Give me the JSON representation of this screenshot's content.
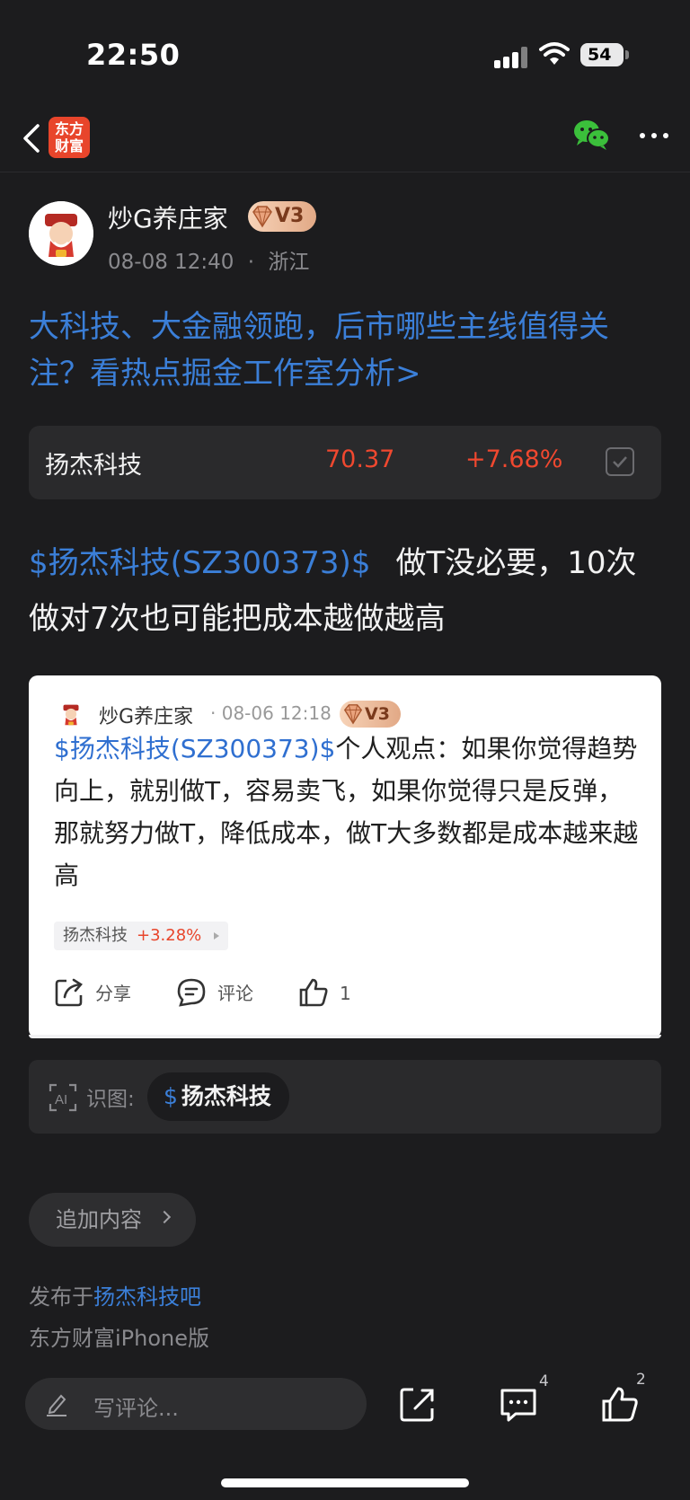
{
  "status_bar": {
    "time": "22:50",
    "battery": "54"
  },
  "nav": {
    "logo_line1": "东方",
    "logo_line2": "财富"
  },
  "author": {
    "name": "炒G养庄家",
    "level": "V3",
    "time": "08-08 12:40",
    "location": "浙江",
    "separator": "·"
  },
  "promo_link": "大科技、大金融领跑，后市哪些主线值得关注？看热点掘金工作室分析>",
  "stock": {
    "name": "扬杰科技",
    "price": "70.37",
    "change": "+7.68%"
  },
  "post": {
    "stock_link": "$扬杰科技(SZ300373)$",
    "text": "做T没必要，10次做对7次也可能把成本越做越高"
  },
  "quote": {
    "author": "炒G养庄家",
    "meta": "· 08-06 12:18",
    "level": "V3",
    "stock_link": "$扬杰科技(SZ300373)$",
    "text": "个人观点：如果你觉得趋势向上，就别做T，容易卖飞，如果你觉得只是反弹，那就努力做T，降低成本，做T大多数都是成本越来越高",
    "tag_name": "扬杰科技",
    "tag_change": "+3.28%",
    "share_label": "分享",
    "comment_label": "评论",
    "like_count": "1"
  },
  "ai": {
    "label": "识图:",
    "chip_symbol": "$",
    "chip_text": "扬杰科技"
  },
  "append_label": "追加内容",
  "publish": {
    "prefix": "发布于",
    "bar": "扬杰科技吧"
  },
  "device": "东方财富iPhone版",
  "bottom": {
    "comment_placeholder": "写评论...",
    "comment_count": "4",
    "like_count": "2"
  },
  "colors": {
    "accent_blue": "#3b7fd8",
    "up_red": "#f0482f",
    "background": "#1c1c1e"
  }
}
